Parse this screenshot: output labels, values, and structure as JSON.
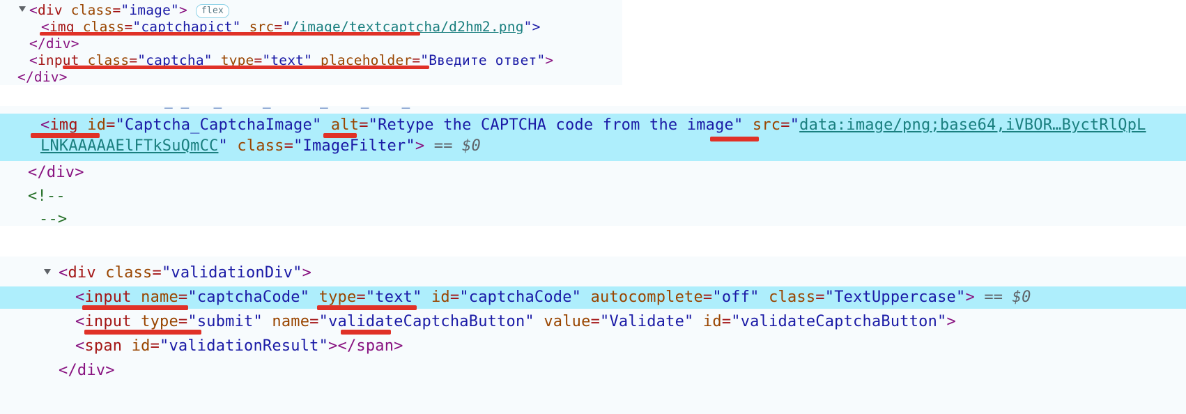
{
  "theme": {
    "panel_bg": "#f7fbfd",
    "page_bg": "#ffffff",
    "highlight_bg": "#aeeefc",
    "annotation_red": "#e03127",
    "tag_color": "#a31515",
    "attr_color": "#994500",
    "value_color": "#1a1aa6",
    "link_color": "#1a7f7f",
    "comment_color": "#236e25",
    "bracket_color": "#881280"
  },
  "sections": {
    "image_div": {
      "name": "image-div-section",
      "lines": {
        "open_div": {
          "lt": "<",
          "tag": "div",
          "attr_class": "class",
          "eq": "=",
          "val_class": "\"image\"",
          "gt": ">",
          "badge": "flex"
        },
        "img_line": {
          "lt": "<",
          "tag": "img",
          "attr_class": "class",
          "val_class": "\"captchapict\"",
          "attr_src": "src",
          "val_src_open": "\"",
          "val_src": "/image/textcaptcha/d2hm2.png",
          "val_src_close": "\">"
        },
        "close_div": "</div>",
        "input_line": {
          "lt": "<",
          "tag": "input",
          "attr_class": "class",
          "val_class": "\"captcha\"",
          "attr_type": "type",
          "val_type": "\"text\"",
          "attr_placeholder": "placeholder",
          "val_placeholder": "\"Введите ответ\"",
          "gt": ">"
        },
        "close_div_outer": "</div>"
      }
    },
    "captcha_image": {
      "name": "captcha-image-section",
      "lines": {
        "img_line_part1": {
          "lt": "<",
          "tag": "img",
          "attr_id": "id",
          "val_id": "\"Captcha_CaptchaImage\"",
          "attr_alt": "alt",
          "val_alt": "\"Retype the CAPTCHA code from the image\"",
          "attr_src": "src",
          "val_src_open": "\"",
          "val_src": "data:image/png;base64,iVBOR…ByctRlQpL"
        },
        "img_line_part2": {
          "val_src_cont": "LNKAAAAAElFTkSuQmCC",
          "quote": "\"",
          "attr_class": "class",
          "val_class": "\"ImageFilter\"",
          "gt": ">",
          "selected_marker": "== $0"
        },
        "close_div": "</div>",
        "comment_open": "<!--",
        "comment_close": "-->"
      }
    },
    "validation_div": {
      "name": "validation-div-section",
      "lines": {
        "open_div": {
          "lt": "<",
          "tag": "div",
          "attr_class": "class",
          "val_class": "\"validationDiv\"",
          "gt": ">"
        },
        "input_code": {
          "lt": "<",
          "tag": "input",
          "attr_name": "name",
          "val_name": "\"captchaCode\"",
          "attr_type": "type",
          "val_type": "\"text\"",
          "attr_id": "id",
          "val_id": "\"captchaCode\"",
          "attr_autocomplete": "autocomplete",
          "val_autocomplete": "\"off\"",
          "attr_class": "class",
          "val_class": "\"TextUppercase\"",
          "gt": ">",
          "selected_marker": "== $0"
        },
        "input_submit": {
          "lt": "<",
          "tag": "input",
          "attr_type": "type",
          "val_type": "\"submit\"",
          "attr_name": "name",
          "val_name": "\"validateCaptchaButton\"",
          "attr_value": "value",
          "val_value": "\"Validate\"",
          "attr_id": "id",
          "val_id": "\"validateCaptchaButton\"",
          "gt": ">"
        },
        "span_result": {
          "lt": "<",
          "tag": "span",
          "attr_id": "id",
          "val_id": "\"validationResult\"",
          "gt": ">",
          "close": "</span>"
        },
        "close_div": "</div>"
      }
    }
  },
  "annotations": {
    "underline_img_src": "/image/textcaptcha/d2hm2.png",
    "underline_placeholder": "placeholder=\"Введите ответ\"",
    "underline_img_id": "<img id",
    "underline_alt": "alt",
    "underline_src_b64": "src",
    "underline_class_image": "age",
    "underline_name_attr": "name=",
    "underline_type_attr": "type=\"text\"",
    "underline_input_type": "input type",
    "underline_submit_name": "\"v"
  }
}
